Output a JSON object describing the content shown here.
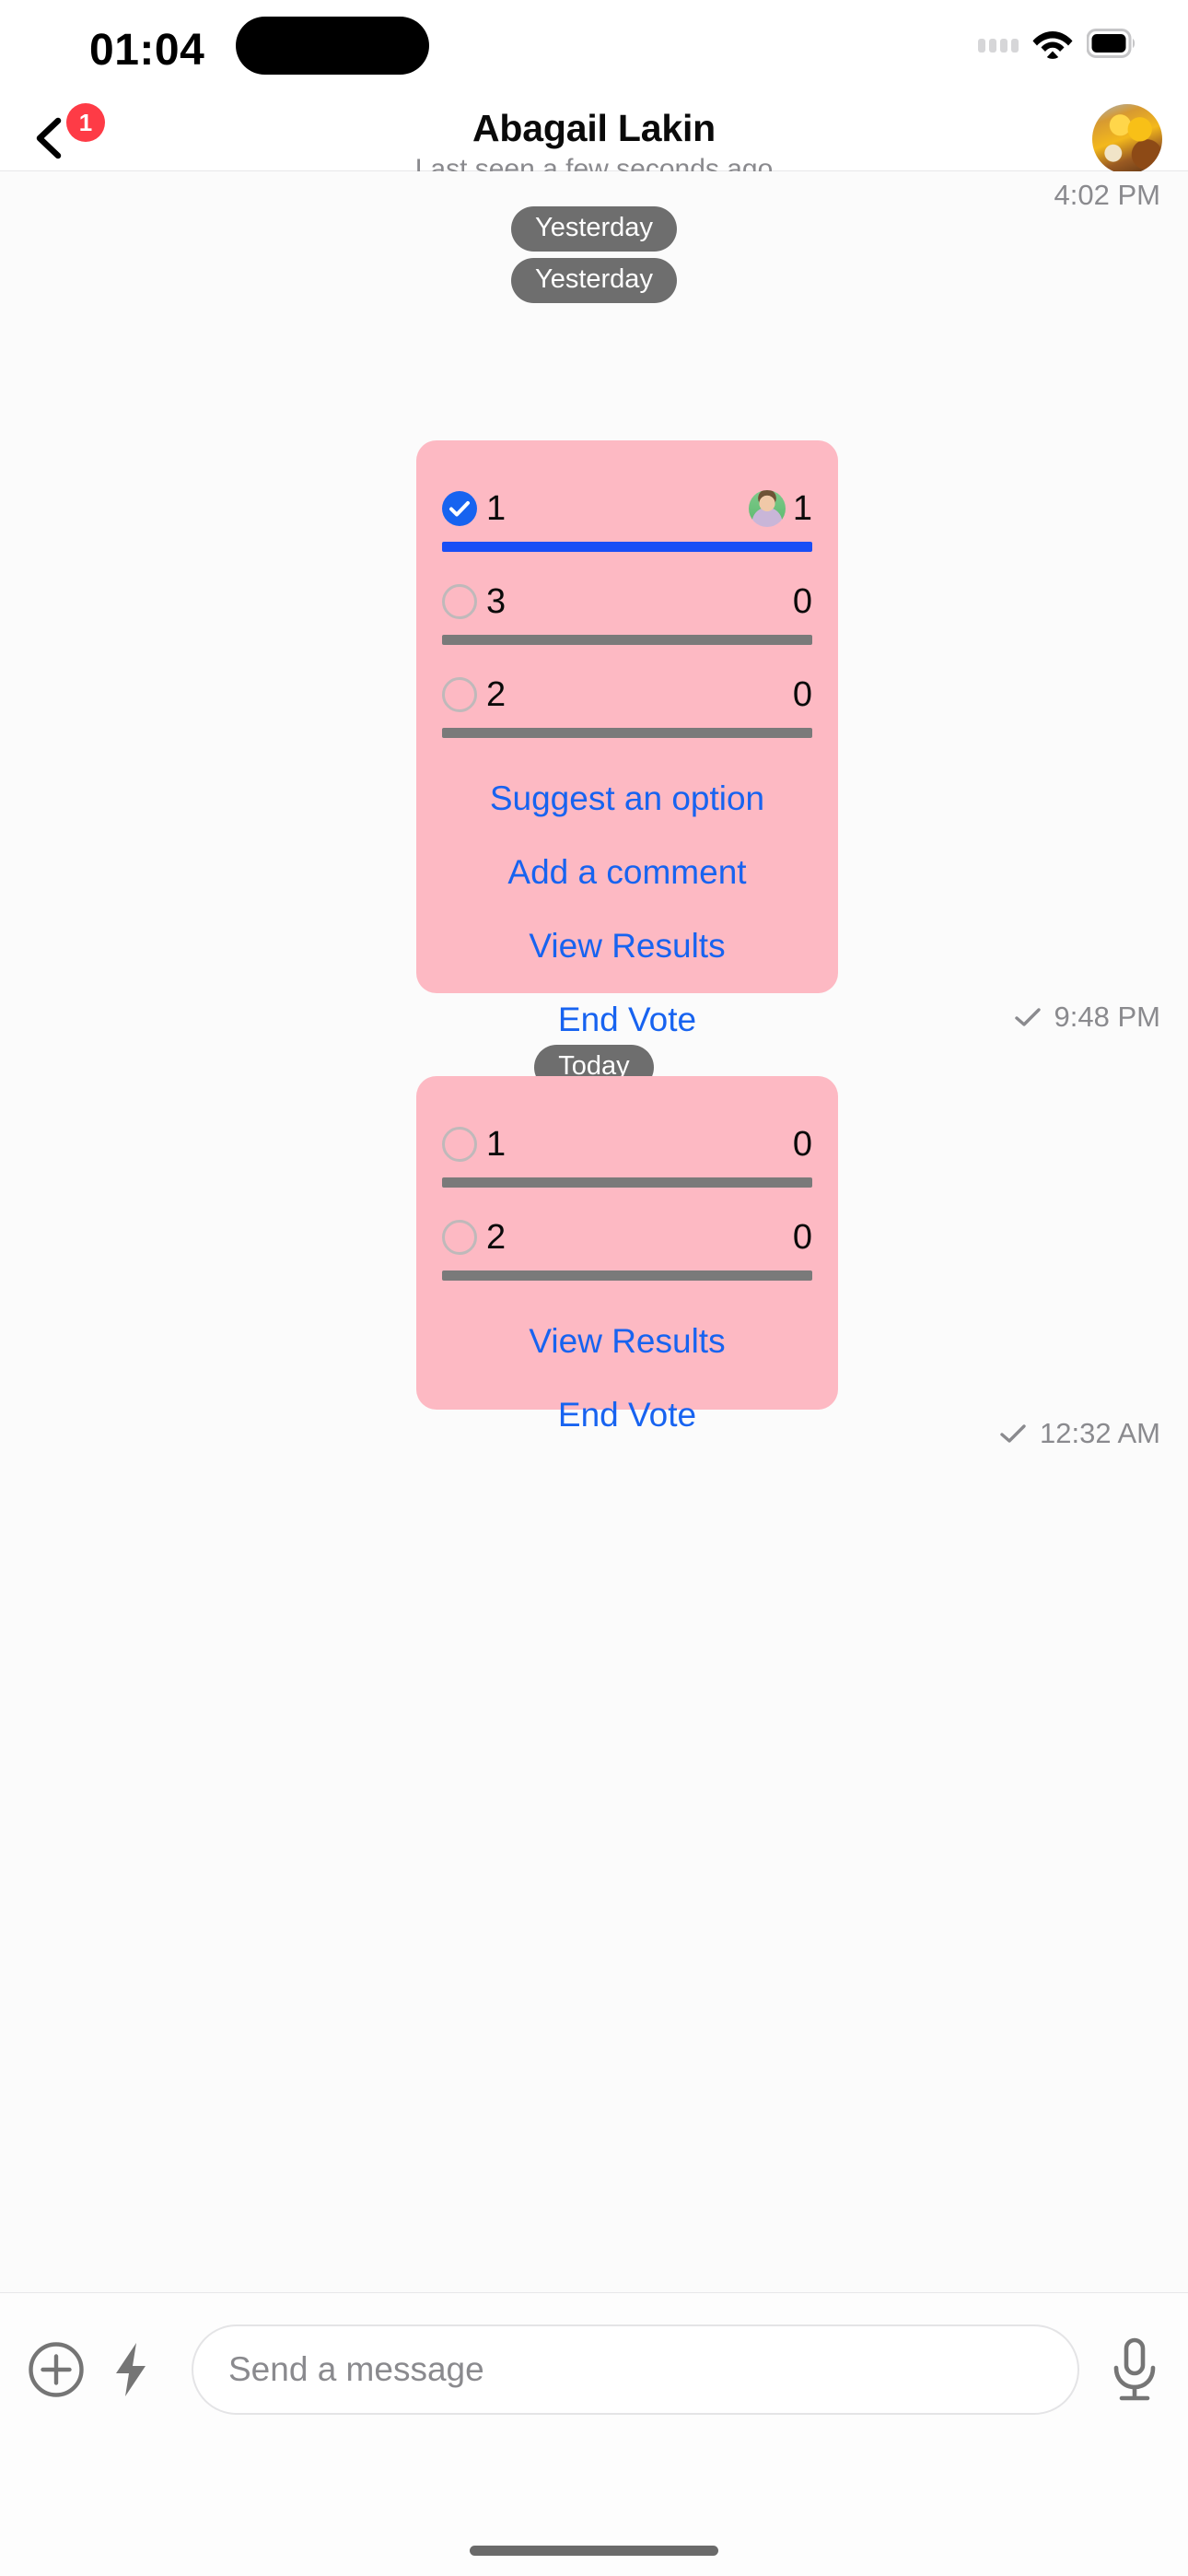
{
  "status_bar": {
    "time": "01:04",
    "cellular_icon": "cellular-dots-icon",
    "wifi_icon": "wifi-icon",
    "battery_icon": "battery-full-icon"
  },
  "header": {
    "back_icon": "chevron-left-icon",
    "unread_badge": "1",
    "peer_name": "Abagail Lakin",
    "peer_status": "Last seen a few seconds ago",
    "avatar_icon": "peer-avatar-image"
  },
  "conversation": {
    "top_timestamp": "4:02 PM",
    "day_separators_first": [
      "Yesterday",
      "Yesterday"
    ],
    "day_separator_second": "Today",
    "polls": [
      {
        "bubble_color": "#fdb9c3",
        "options": [
          {
            "label": "1",
            "count": "1",
            "selected": true,
            "voter_avatar": "voter-avatar-image",
            "bar_pct": 100,
            "bar_color": "#1a4ef5"
          },
          {
            "label": "3",
            "count": "0",
            "selected": false,
            "voter_avatar": null,
            "bar_pct": 100,
            "bar_color": "#7a7a7a"
          },
          {
            "label": "2",
            "count": "0",
            "selected": false,
            "voter_avatar": null,
            "bar_pct": 100,
            "bar_color": "#7a7a7a"
          }
        ],
        "actions": [
          "Suggest an option",
          "Add a comment",
          "View Results",
          "End Vote"
        ],
        "receipt": {
          "tick_icon": "single-check-icon",
          "time": "9:48 PM"
        }
      },
      {
        "bubble_color": "#fdb9c3",
        "options": [
          {
            "label": "1",
            "count": "0",
            "selected": false,
            "voter_avatar": null,
            "bar_pct": 100,
            "bar_color": "#7a7a7a"
          },
          {
            "label": "2",
            "count": "0",
            "selected": false,
            "voter_avatar": null,
            "bar_pct": 100,
            "bar_color": "#7a7a7a"
          }
        ],
        "actions": [
          "View Results",
          "End Vote"
        ],
        "receipt": {
          "tick_icon": "single-check-icon",
          "time": "12:32 AM"
        }
      }
    ]
  },
  "composer": {
    "attach_icon": "plus-circle-icon",
    "quick_action_icon": "lightning-bolt-icon",
    "placeholder": "Send a message",
    "input_value": "",
    "mic_icon": "microphone-icon"
  },
  "colors": {
    "accent_link": "#1763f0",
    "selected_bar": "#1a4ef5",
    "unselected_bar": "#7a7a7a",
    "bubble_pink": "#fdb9c3",
    "badge_red": "#fe3b46",
    "muted_text": "#8a8a8e",
    "pill_gray": "#6e6e6e"
  }
}
